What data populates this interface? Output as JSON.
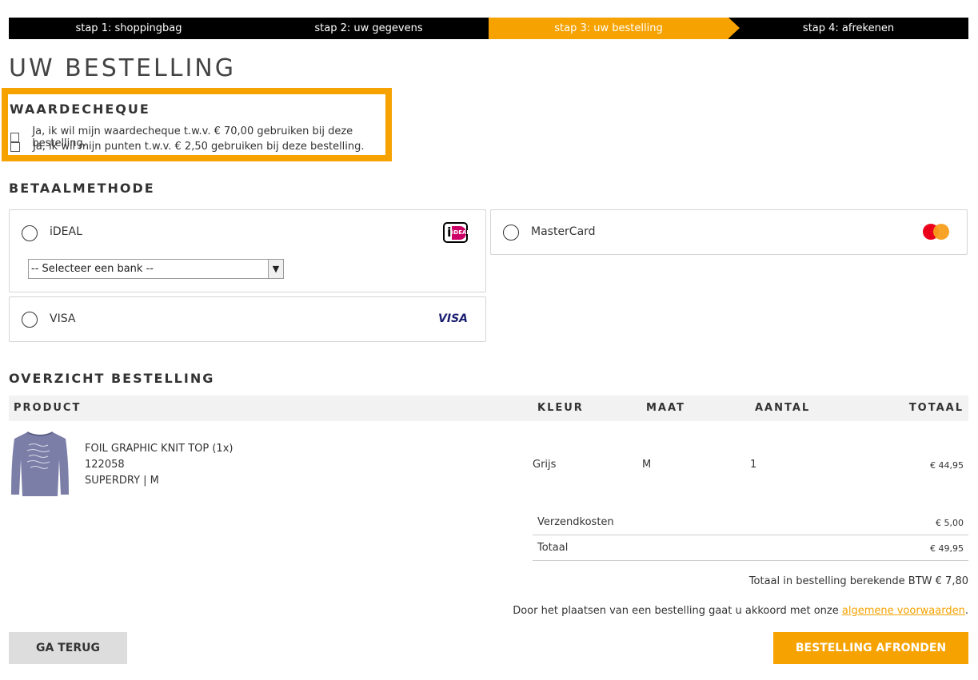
{
  "steps": [
    {
      "label": "stap 1: shoppingbag",
      "active": false
    },
    {
      "label": "stap 2: uw gegevens",
      "active": false
    },
    {
      "label": "stap 3: uw bestelling",
      "active": true
    },
    {
      "label": "stap 4: afrekenen",
      "active": false
    }
  ],
  "page_title": "UW BESTELLING",
  "voucher": {
    "title": "WAARDECHEQUE",
    "options": [
      "Ja, ik wil mijn waardecheque t.w.v. € 70,00 gebruiken bij deze bestelling.",
      "Ja, ik wil mijn punten t.w.v. € 2,50 gebruiken bij deze bestelling."
    ]
  },
  "payment": {
    "title": "BETAALMETHODE",
    "methods": [
      "iDEAL",
      "MasterCard",
      "VISA"
    ],
    "bank_select": "-- Selecteer een bank --",
    "ideal_logo_text": "iDEAL",
    "visa_logo_text": "VISA"
  },
  "overview": {
    "title": "OVERZICHT BESTELLING",
    "headers": [
      "PRODUCT",
      "KLEUR",
      "MAAT",
      "AANTAL",
      "TOTAAL"
    ],
    "product": {
      "name": "FOIL GRAPHIC KNIT TOP (1x)",
      "sku": "122058",
      "brand_size": "SUPERDRY | M",
      "color": "Grijs",
      "size": "M",
      "quantity": "1",
      "total": "€ 44,95"
    },
    "shipping_label": "Verzendkosten",
    "shipping_value": "€ 5,00",
    "total_label": "Totaal",
    "total_value": "€ 49,95",
    "btw_text": "Totaal in bestelling berekende BTW € 7,80",
    "terms_text": "Door het plaatsen van een bestelling gaat u akkoord met onze ",
    "terms_link": "algemene voorwaarden",
    "terms_end": "."
  },
  "buttons": {
    "back": "GA TERUG",
    "finish": "BESTELLING AFRONDEN"
  },
  "colors": {
    "accent": "#f6a200",
    "bar": "#000000"
  }
}
